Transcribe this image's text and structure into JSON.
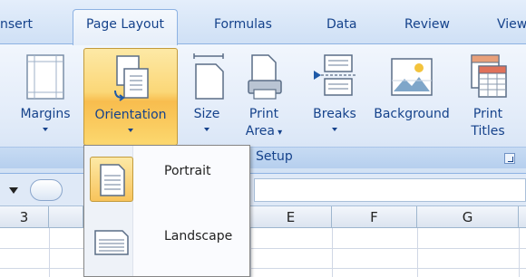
{
  "tabs": [
    {
      "label": "nsert"
    },
    {
      "label": "Page Layout",
      "active": true
    },
    {
      "label": "Formulas"
    },
    {
      "label": "Data"
    },
    {
      "label": "Review"
    },
    {
      "label": "View"
    }
  ],
  "ribbon": {
    "buttons": [
      {
        "label": "Margins",
        "icon": "margins-icon"
      },
      {
        "label": "Orientation",
        "icon": "orientation-icon",
        "pressed": true
      },
      {
        "label": "Size",
        "icon": "size-icon"
      },
      {
        "label": "Print",
        "label2": "Area",
        "icon": "print-area-icon"
      },
      {
        "label": "Breaks",
        "icon": "breaks-icon"
      },
      {
        "label": "Background",
        "icon": "background-icon"
      },
      {
        "label": "Print",
        "label2": "Titles",
        "icon": "print-titles-icon"
      }
    ],
    "group_label": "Setup"
  },
  "sheet": {
    "columns": [
      "3",
      "E",
      "F",
      "G"
    ]
  },
  "orientation_menu": {
    "items": [
      {
        "label": "Portrait",
        "icon": "portrait-page-icon",
        "highlighted": true
      },
      {
        "label": "Landscape",
        "icon": "landscape-page-icon"
      }
    ]
  },
  "colors": {
    "accent_text": "#15428b",
    "pressed_orange": "#f8bd4e",
    "ribbon_blue": "#dfe9f7"
  }
}
